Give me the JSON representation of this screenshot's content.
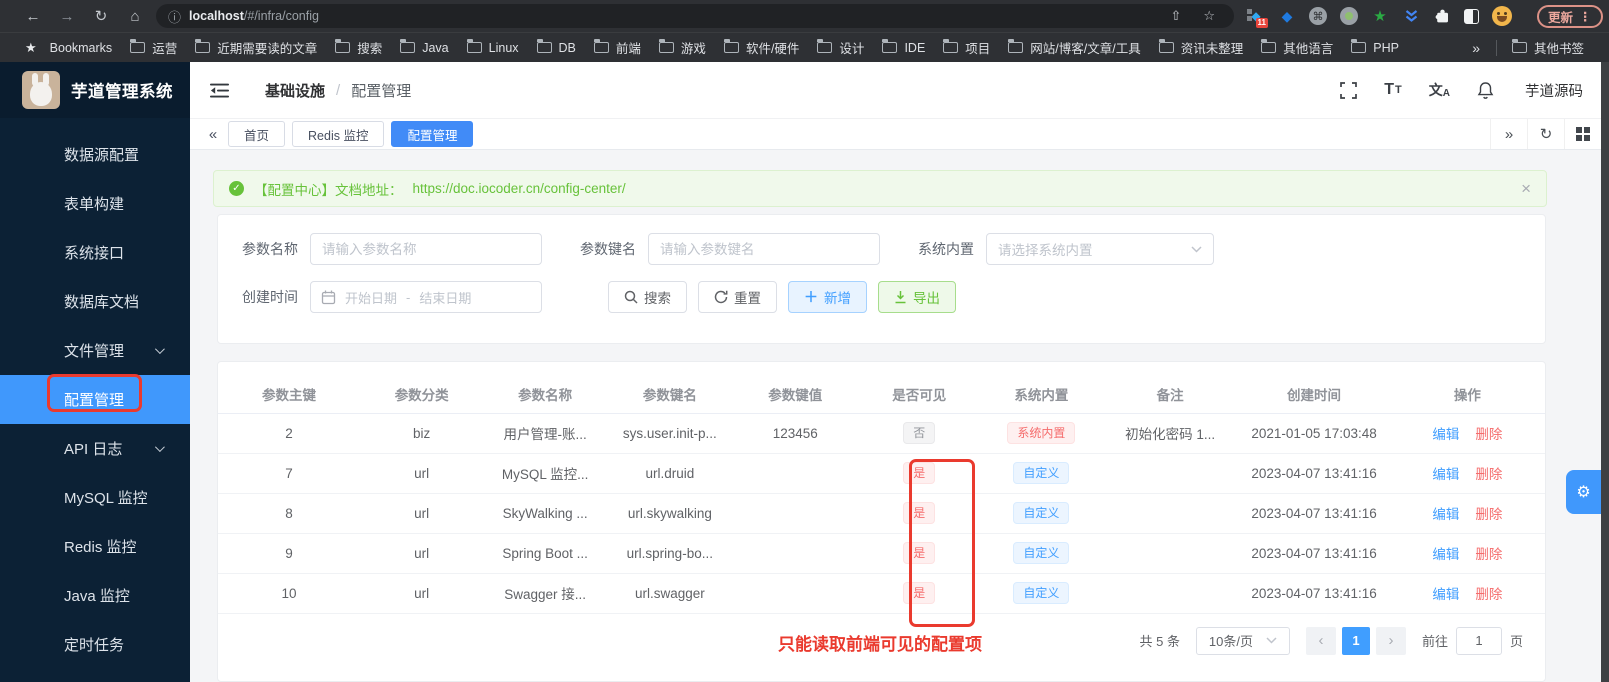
{
  "browser": {
    "url_host": "localhost",
    "url_path": "/#/infra/config",
    "bookmarks_label": "Bookmarks",
    "bookmarks": [
      "运营",
      "近期需要读的文章",
      "搜索",
      "Java",
      "Linux",
      "DB",
      "前端",
      "游戏",
      "软件/硬件",
      "设计",
      "IDE",
      "项目",
      "网站/博客/文章/工具",
      "资讯未整理",
      "其他语言",
      "PHP"
    ],
    "bookmarks_overflow": "»",
    "other_bookmarks": "其他书签",
    "extension_badge": "11",
    "update_label": "更新"
  },
  "icons": {
    "back": "←",
    "forward": "→",
    "reload": "↻",
    "home": "⌂",
    "info": "ⓘ",
    "share": "⇧",
    "star": "☆",
    "bookmarks_star": "★",
    "command": "⌘",
    "ext_diamond": "◆",
    "ext_gem": "◆",
    "ext_star": "★",
    "menu_dots": "⋮",
    "collapse": "«",
    "expand": "»",
    "refresh": "↻",
    "close": "×",
    "check": "✓",
    "gear": "⚙",
    "font_big": "T",
    "font_small": "T",
    "lang_cn": "文",
    "lang_en": "A",
    "prev": "‹",
    "next": "›"
  },
  "sidebar": {
    "title": "芋道管理系统",
    "items": [
      {
        "label": "数据源配置",
        "chevron": false,
        "active": false
      },
      {
        "label": "表单构建",
        "chevron": false,
        "active": false
      },
      {
        "label": "系统接口",
        "chevron": false,
        "active": false
      },
      {
        "label": "数据库文档",
        "chevron": false,
        "active": false
      },
      {
        "label": "文件管理",
        "chevron": true,
        "active": false
      },
      {
        "label": "配置管理",
        "chevron": false,
        "active": true
      },
      {
        "label": "API 日志",
        "chevron": true,
        "active": false
      },
      {
        "label": "MySQL 监控",
        "chevron": false,
        "active": false
      },
      {
        "label": "Redis 监控",
        "chevron": false,
        "active": false
      },
      {
        "label": "Java 监控",
        "chevron": false,
        "active": false
      },
      {
        "label": "定时任务",
        "chevron": false,
        "active": false
      }
    ]
  },
  "header": {
    "breadcrumb_root": "基础设施",
    "breadcrumb_sep": "/",
    "breadcrumb_current": "配置管理",
    "username": "芋道源码"
  },
  "tabbar": {
    "tabs": [
      {
        "label": "首页",
        "active": false
      },
      {
        "label": "Redis 监控",
        "active": false
      },
      {
        "label": "配置管理",
        "active": true
      }
    ]
  },
  "banner": {
    "text": "【配置中心】文档地址：",
    "link": "https://doc.iocoder.cn/config-center/"
  },
  "search": {
    "fields": [
      {
        "label": "参数名称",
        "placeholder": "请输入参数名称"
      },
      {
        "label": "参数键名",
        "placeholder": "请输入参数键名"
      },
      {
        "label": "系统内置",
        "placeholder": "请选择系统内置"
      },
      {
        "label": "创建时间",
        "start_placeholder": "开始日期",
        "separator": "-",
        "end_placeholder": "结束日期"
      }
    ],
    "buttons": {
      "search": "搜索",
      "reset": "重置",
      "add": "新增",
      "export": "导出"
    }
  },
  "table": {
    "headers": [
      "参数主键",
      "参数分类",
      "参数名称",
      "参数键名",
      "参数键值",
      "是否可见",
      "系统内置",
      "备注",
      "创建时间",
      "操作"
    ],
    "rows": [
      {
        "id": "2",
        "category": "biz",
        "name": "用户管理-账...",
        "key": "sys.user.init-p...",
        "value": "123456",
        "visible": "否",
        "builtin": "系统内置",
        "remark": "初始化密码 1...",
        "created": "2021-01-05 17:03:48"
      },
      {
        "id": "7",
        "category": "url",
        "name": "MySQL 监控...",
        "key": "url.druid",
        "value": "",
        "visible": "是",
        "builtin": "自定义",
        "remark": "",
        "created": "2023-04-07 13:41:16"
      },
      {
        "id": "8",
        "category": "url",
        "name": "SkyWalking ...",
        "key": "url.skywalking",
        "value": "",
        "visible": "是",
        "builtin": "自定义",
        "remark": "",
        "created": "2023-04-07 13:41:16"
      },
      {
        "id": "9",
        "category": "url",
        "name": "Spring Boot ...",
        "key": "url.spring-bo...",
        "value": "",
        "visible": "是",
        "builtin": "自定义",
        "remark": "",
        "created": "2023-04-07 13:41:16"
      },
      {
        "id": "10",
        "category": "url",
        "name": "Swagger 接...",
        "key": "url.swagger",
        "value": "",
        "visible": "是",
        "builtin": "自定义",
        "remark": "",
        "created": "2023-04-07 13:41:16"
      }
    ],
    "actions": {
      "edit": "编辑",
      "delete": "删除"
    }
  },
  "pagination": {
    "total": "共 5 条",
    "page_size": "10条/页",
    "current_page": "1",
    "goto_label": "前往",
    "goto_value": "1",
    "page_label": "页"
  },
  "annotation": {
    "note": "只能读取前端可见的配置项"
  },
  "colors": {
    "accent_blue": "#409eff",
    "success_green": "#67c23a",
    "danger_red": "#f56c6c",
    "annotation_red": "#ea3a2e",
    "sidebar_dark": "#0c2135"
  }
}
